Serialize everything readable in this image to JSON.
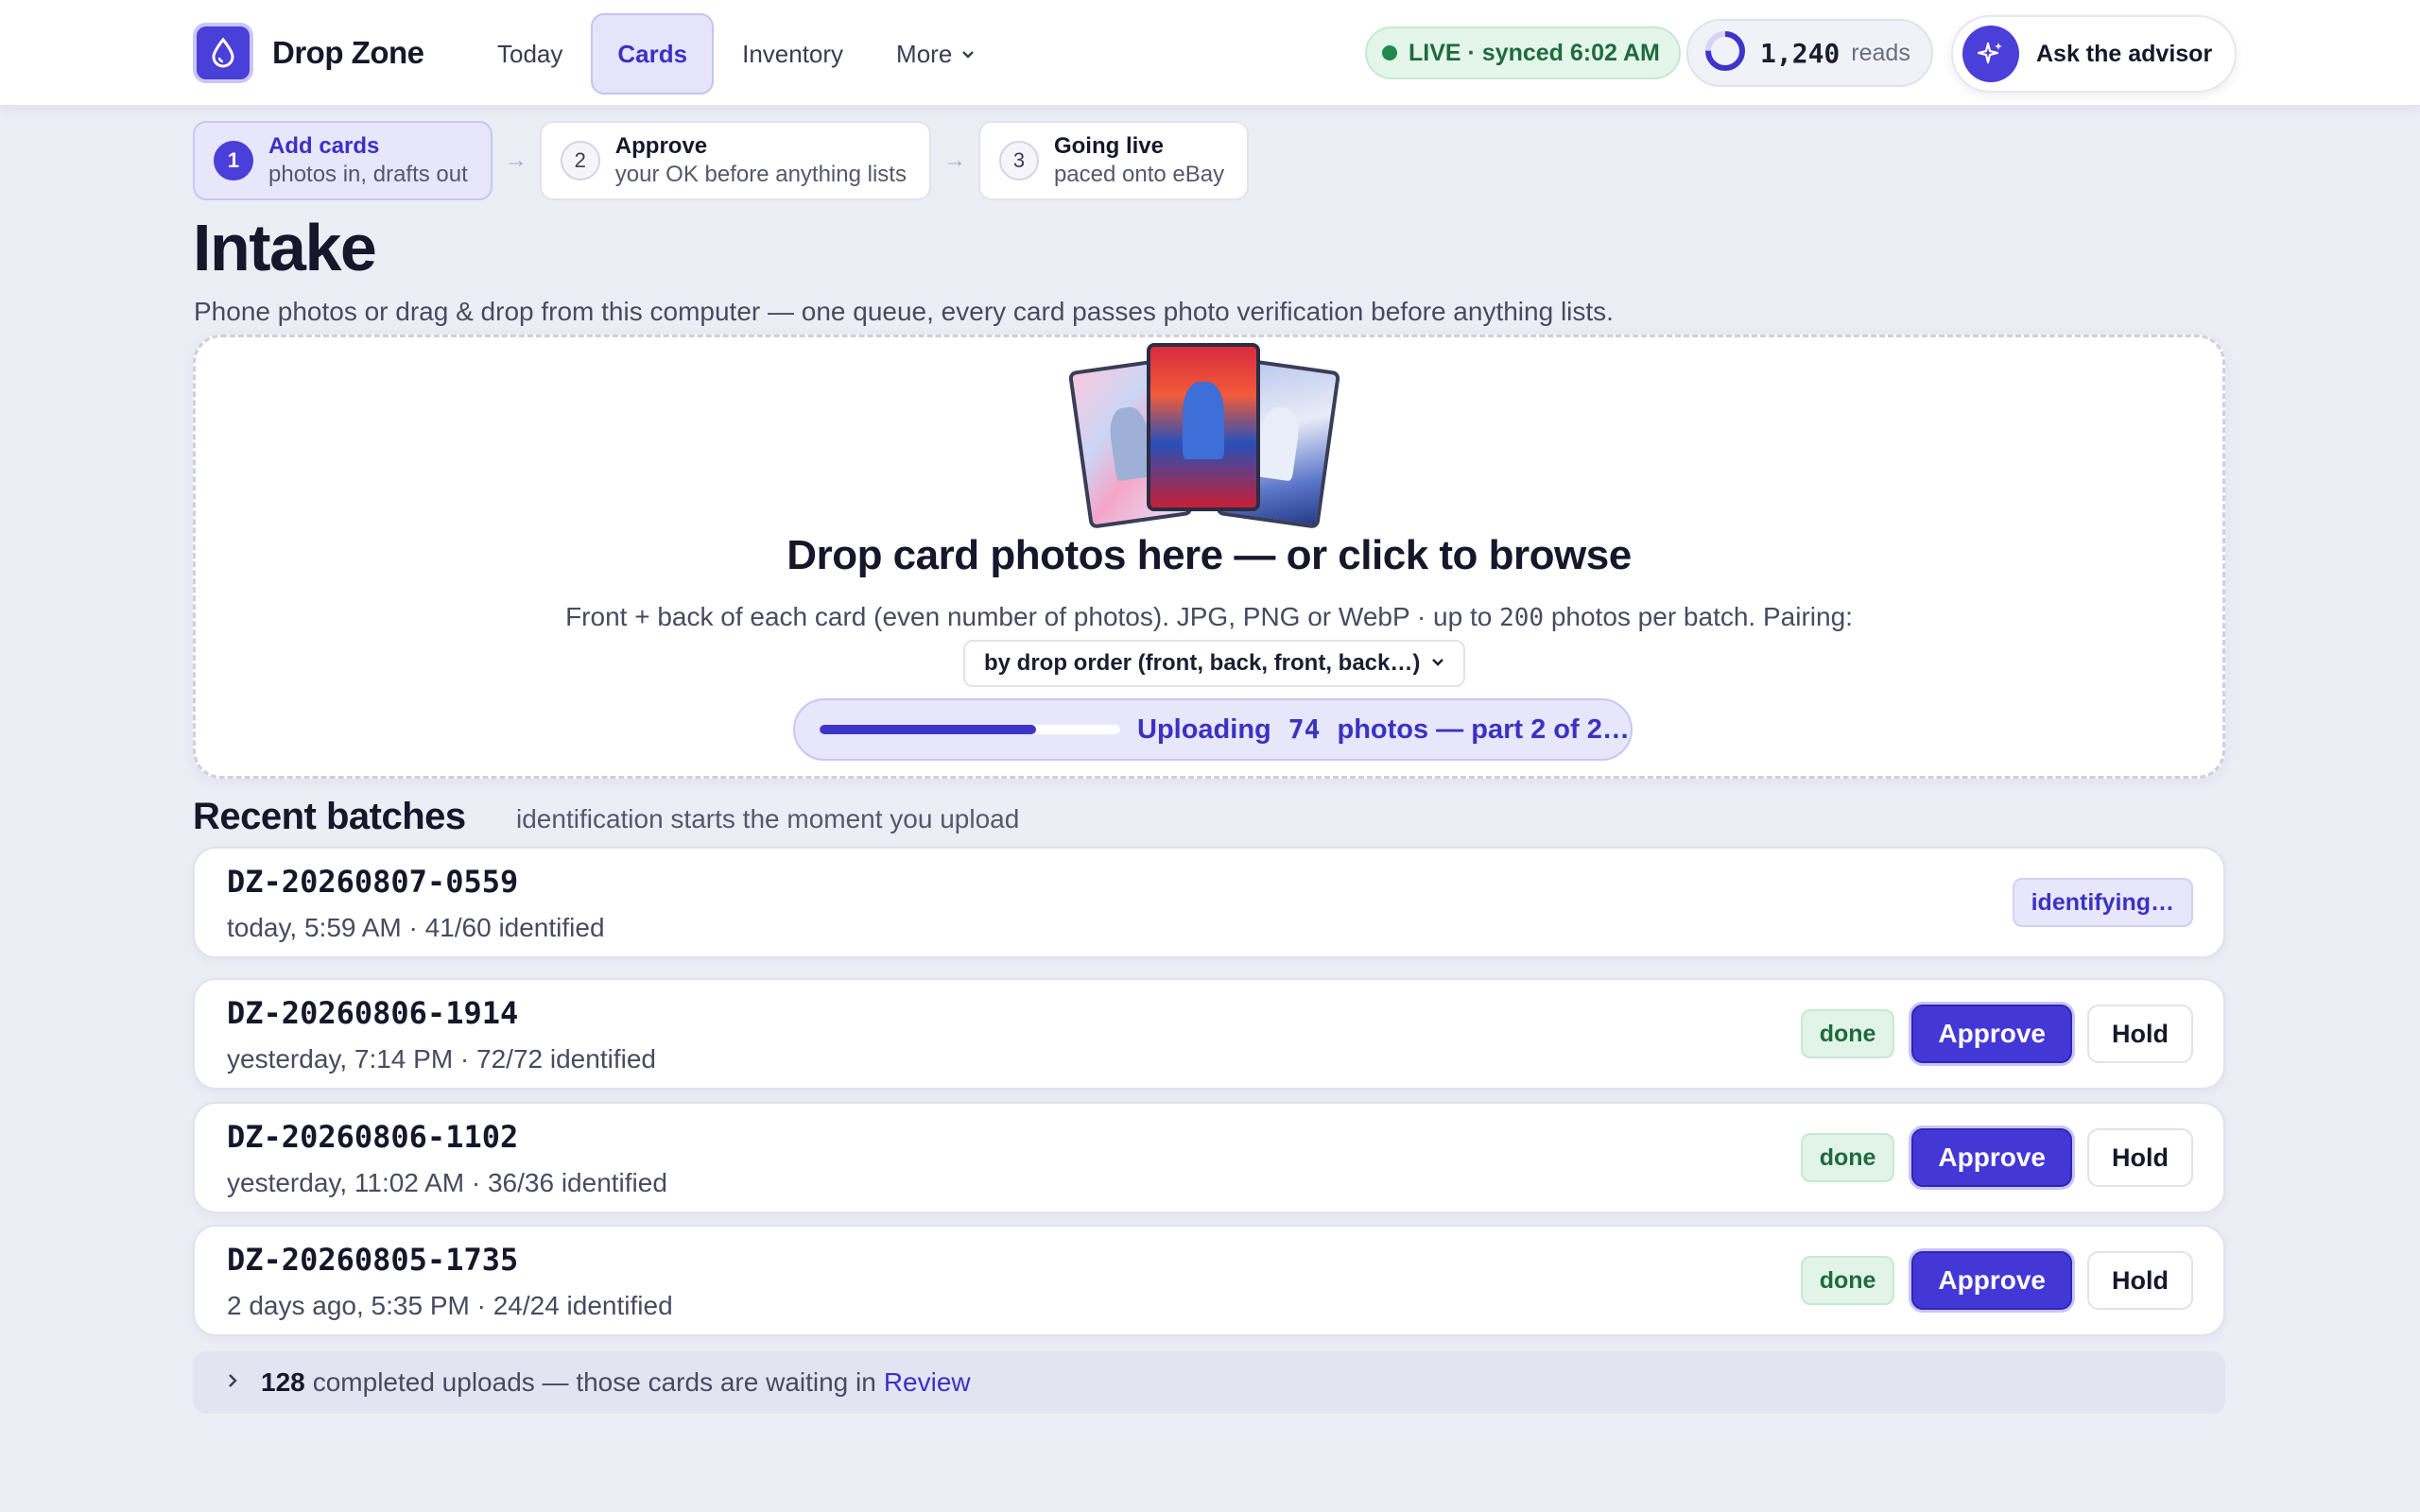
{
  "app": {
    "name": "Drop Zone"
  },
  "nav": {
    "items": [
      {
        "label": "Today"
      },
      {
        "label": "Cards",
        "active": true
      },
      {
        "label": "Inventory"
      },
      {
        "label": "More"
      }
    ]
  },
  "status": {
    "live": "LIVE",
    "synced": "synced 6:02 AM",
    "reads_count": "1,240",
    "reads_label": "reads",
    "advisor_label": "Ask the advisor"
  },
  "stepper": [
    {
      "num": "1",
      "title": "Add cards",
      "sub": "photos in, drafts out",
      "active": true
    },
    {
      "num": "2",
      "title": "Approve",
      "sub": "your OK before anything lists"
    },
    {
      "num": "3",
      "title": "Going live",
      "sub": "paced onto eBay"
    }
  ],
  "page": {
    "title": "Intake",
    "subtitle": "Phone photos or drag & drop from this computer — one queue, every card passes photo verification before anything lists."
  },
  "dropzone": {
    "title": "Drop card photos here — or click to browse",
    "desc_before": "Front + back of each card (even number of photos). JPG, PNG or WebP · up to ",
    "max_photos": "200",
    "desc_after": " photos per batch. Pairing:",
    "pairing_selected": "by drop order (front, back, front, back…)",
    "upload_prefix": "Uploading",
    "upload_count": "74",
    "upload_suffix": "photos — part 2 of 2…",
    "upload_progress": 0.72
  },
  "batches_section": {
    "title": "Recent batches",
    "note": "identification starts the moment you upload"
  },
  "batches": [
    {
      "id": "DZ-20260807-0559",
      "meta": "today, 5:59 AM · 41/60 identified",
      "status": "identifying…"
    },
    {
      "id": "DZ-20260806-1914",
      "meta": "yesterday, 7:14 PM · 72/72 identified",
      "status": "done"
    },
    {
      "id": "DZ-20260806-1102",
      "meta": "yesterday, 11:02 AM · 36/36 identified",
      "status": "done"
    },
    {
      "id": "DZ-20260805-1735",
      "meta": "2 days ago, 5:35 PM · 24/24 identified",
      "status": "done"
    }
  ],
  "actions": {
    "approve": "Approve",
    "hold": "Hold"
  },
  "completed": {
    "count": "128",
    "text": "completed uploads — those cards are waiting in",
    "link": "Review"
  },
  "colors": {
    "accent": "#4338d6",
    "live": "#1f8a4c",
    "background": "#eceef6"
  },
  "icons": [
    "drop-icon",
    "chevron-down-icon",
    "ring-gauge-icon",
    "sparkle-icon",
    "chevron-right-icon"
  ]
}
